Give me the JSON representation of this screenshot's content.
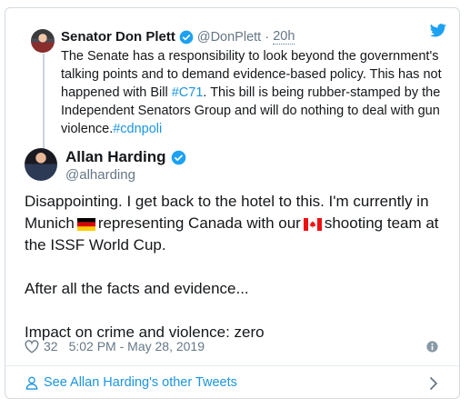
{
  "parent_tweet": {
    "name": "Senator Don Plett",
    "handle": "@DonPlett",
    "separator": "·",
    "time": "20h",
    "text_line1": "The Senate has a responsibility to look beyond the government's talking points and to demand evidence-based policy.  This has not happened with Bill ",
    "hashtag1": "#C71",
    "text_line2": ". This bill is being rubber-stamped by the Independent Senators Group and will do nothing to deal with gun violence.",
    "hashtag2": "#cdnpoli"
  },
  "tweet": {
    "name": "Allan Harding",
    "handle": "@alharding",
    "p1_a": "Disappointing. I get back to the hotel to this. I'm currently in Munich",
    "p1_b": "representing Canada with our",
    "p1_c": "shooting team at the ISSF World Cup.",
    "p2": "After all the facts and evidence...",
    "p3": "Impact on crime and violence: zero",
    "likes": "32",
    "timestamp": "5:02 PM - May 28, 2019"
  },
  "footer": {
    "link_text": "See Allan Harding's other Tweets"
  },
  "colors": {
    "link": "#1b95e0",
    "muted": "#657786",
    "verified": "#1da1f2"
  }
}
